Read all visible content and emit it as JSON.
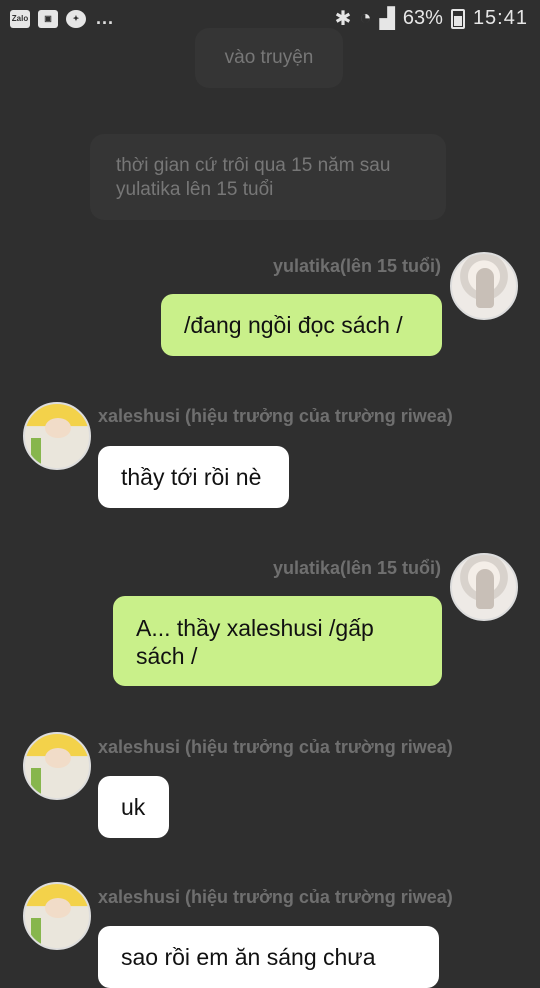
{
  "status_bar": {
    "left_icons": [
      "zalo-app-icon",
      "gallery-icon",
      "messenger-icon"
    ],
    "zalo_label": "Zalo",
    "more": "...",
    "battery": "63%",
    "time": "15:41"
  },
  "narrations": [
    {
      "text": "vào truyện"
    },
    {
      "text": "thời gian cứ trôi qua 15 năm sau yulatika lên 15 tuổi"
    }
  ],
  "messages": [
    {
      "side": "right",
      "sender": "yulatika(lên 15 tuổi)",
      "text": "/đang ngồi đọc sách /",
      "avatar": "girl-avatar"
    },
    {
      "side": "left",
      "sender": "xaleshusi (hiệu trưởng của trường riwea)",
      "text": "thầy tới rồi nè",
      "avatar": "boy-avatar"
    },
    {
      "side": "right",
      "sender": "yulatika(lên 15 tuổi)",
      "text": "A... thầy xaleshusi /gấp sách /",
      "avatar": "girl-avatar"
    },
    {
      "side": "left",
      "sender": "xaleshusi (hiệu trưởng của trường riwea)",
      "text": "uk",
      "avatar": "boy-avatar"
    },
    {
      "side": "left",
      "sender": "xaleshusi (hiệu trưởng của trường riwea)",
      "text": "sao rồi em ăn sáng chưa",
      "avatar": "boy-avatar"
    }
  ],
  "colors": {
    "background": "#2f2f2f",
    "own_bubble": "#c9f08a",
    "other_bubble": "#ffffff"
  }
}
